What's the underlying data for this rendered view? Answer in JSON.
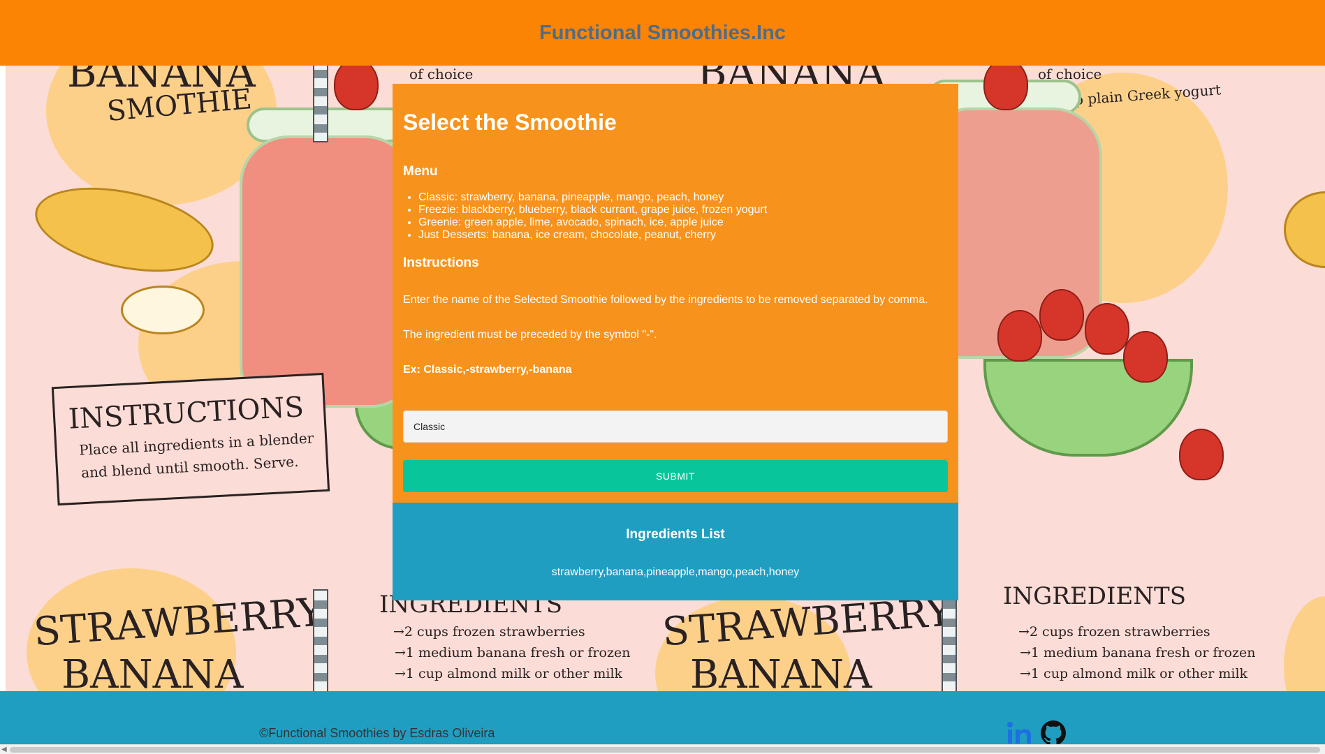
{
  "header": {
    "title": "Functional Smoothies.Inc"
  },
  "background_art": {
    "texts": {
      "banana_title": "BANANA",
      "smothie": "SMOTHIE",
      "of_choice_1": "of choice",
      "of_choice_2": "of choice",
      "yogurt": "• ½ cup plain Greek yogurt",
      "instructions_title": "INSTRUCTIONS",
      "instructions_line1": "Place all ingredients in a blender",
      "instructions_line2": "and blend until smooth. Serve.",
      "strawberry_1": "STRAWBERRY",
      "strawberry_2": "STRAWBERRY",
      "banana_bottom_1": "BANANA",
      "banana_bottom_2": "BANANA",
      "ingredients_1": "INGREDIENTS",
      "ingredients_2": "INGREDIENTS",
      "ing_a1": "→2 cups frozen strawberries",
      "ing_a2": "→1 medium banana fresh or frozen",
      "ing_a3": "→1 cup almond milk or other milk",
      "ing_b1": "→2 cups frozen strawberries",
      "ing_b2": "→1 medium banana fresh or frozen",
      "ing_b3": "→1 cup almond milk or other milk"
    }
  },
  "panel": {
    "title": "Select the Smoothie",
    "menu_heading": "Menu",
    "menu_items": [
      "Classic: strawberry, banana, pineapple, mango, peach, honey",
      "Freezie: blackberry, blueberry, black currant, grape juice, frozen yogurt",
      "Greenie: green apple, lime, avocado, spinach, ice, apple juice",
      "Just Desserts: banana, ice cream, chocolate, peanut, cherry"
    ],
    "instructions_heading": "Instructions",
    "instruction_1": "Enter the name of the Selected Smoothie followed by the ingredients to be removed separated by comma.",
    "instruction_2": "The ingredient must be preceded by the symbol \"-\".",
    "example": "Ex: Classic,-strawberry,-banana",
    "input_value": "Classic",
    "submit_label": "SUBMIT"
  },
  "result": {
    "heading": "Ingredients List",
    "ingredients": "strawberry,banana,pineapple,mango,peach,honey"
  },
  "footer": {
    "copyright": "©Functional Smoothies by Esdras Oliveira",
    "linkedin_icon": "linkedin-icon",
    "github_icon": "github-icon"
  },
  "colors": {
    "header_bg": "#fb8404",
    "title_text": "#4f6c8a",
    "panel_bg": "#f7931d",
    "submit_bg": "#08c59b",
    "result_bg": "#209ec1",
    "footer_bg": "#209ec1",
    "linkedin": "#1d6fe3"
  }
}
